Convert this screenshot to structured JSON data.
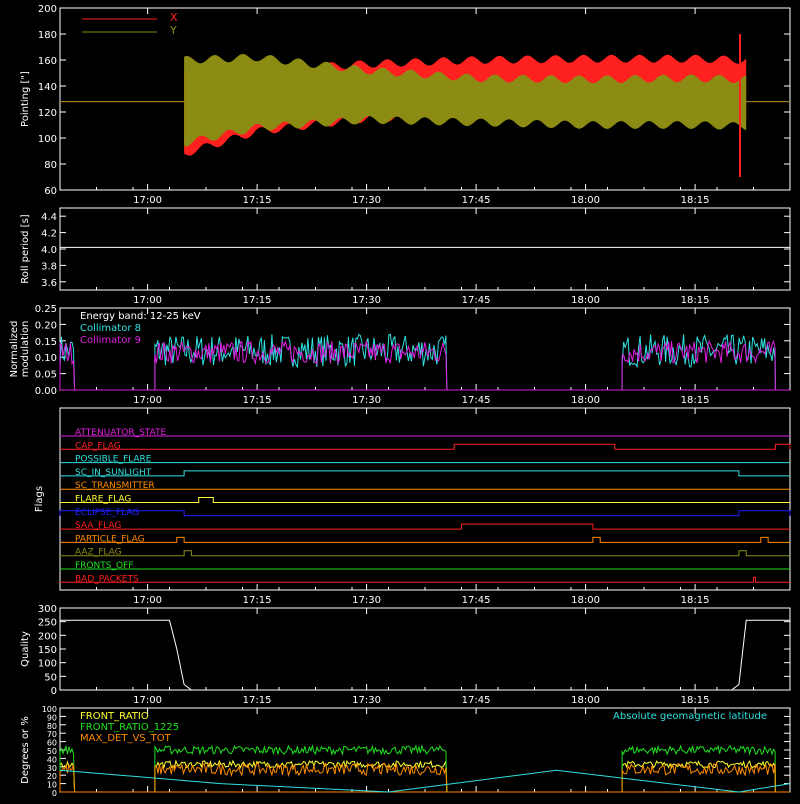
{
  "colors": {
    "background": "#000000",
    "axes": "#ffffff",
    "red": "#ff2020",
    "olive": "#8c8c14",
    "cyan": "#30e0e0",
    "magenta": "#e020e0",
    "green": "#20e020",
    "orange": "#ff8c00",
    "yellow": "#ffff30",
    "blue": "#2020ff",
    "pink": "#ff40a0",
    "white": "#ffffff"
  },
  "time_axis": {
    "start": "16:48",
    "end": "18:28",
    "ticks": [
      "17:00",
      "17:15",
      "17:30",
      "17:45",
      "18:00",
      "18:15"
    ]
  },
  "chart_data": [
    {
      "id": "pointing",
      "type": "area",
      "ylabel": "Pointing [\"]",
      "ylim": [
        60,
        200
      ],
      "yticks": [
        60,
        80,
        100,
        120,
        140,
        160,
        180,
        200
      ],
      "legend": {
        "placement": "top-left",
        "entries": [
          "X",
          "Y"
        ]
      },
      "series": [
        {
          "name": "X",
          "color": "red",
          "x": [
            "16:48",
            "17:05",
            "17:15",
            "17:30",
            "17:45",
            "18:00",
            "18:15",
            "18:22",
            "18:28"
          ],
          "lower": [
            128,
            88,
            105,
            115,
            117,
            117,
            116,
            115,
            128
          ],
          "upper": [
            128,
            150,
            152,
            157,
            160,
            161,
            161,
            160,
            128
          ]
        },
        {
          "name": "Y",
          "color": "olive",
          "x": [
            "16:48",
            "17:05",
            "17:15",
            "17:30",
            "17:45",
            "18:00",
            "18:15",
            "18:22",
            "18:28"
          ],
          "lower": [
            128,
            96,
            108,
            114,
            112,
            110,
            110,
            109,
            128
          ],
          "upper": [
            128,
            160,
            162,
            152,
            146,
            145,
            146,
            145,
            128
          ]
        }
      ]
    },
    {
      "id": "roll",
      "type": "line",
      "ylabel": "Roll period [s]",
      "ylim": [
        3.5,
        4.5
      ],
      "yticks": [
        3.6,
        3.8,
        4.0,
        4.2,
        4.4
      ],
      "series": [
        {
          "color": "white",
          "x": [
            "16:48",
            "18:28"
          ],
          "y": [
            4.02,
            4.02
          ]
        }
      ]
    },
    {
      "id": "modulation",
      "type": "line",
      "ylabel": "Normalized modulation",
      "ylim": [
        0,
        0.25
      ],
      "yticks": [
        0.0,
        0.05,
        0.1,
        0.15,
        0.2,
        0.25
      ],
      "annotation": "Energy band: 12-25 keV",
      "legend": {
        "placement": "top-left",
        "entries": [
          "Collimator 8",
          "Collimator 9"
        ]
      },
      "segments": [
        [
          "16:48",
          "16:50"
        ],
        [
          "17:01",
          "17:41"
        ],
        [
          "18:05",
          "18:26"
        ]
      ],
      "series": [
        {
          "name": "Collimator 8",
          "color": "cyan",
          "mean": 0.12,
          "spread": 0.05
        },
        {
          "name": "Collimator 9",
          "color": "magenta",
          "mean": 0.115,
          "spread": 0.035
        }
      ]
    },
    {
      "id": "flags",
      "type": "line",
      "ylabel": "Flags",
      "rows": [
        {
          "name": "ATTENUATOR_STATE",
          "color": "magenta",
          "highs": []
        },
        {
          "name": "CAP_FLAG",
          "color": "red",
          "highs": [
            [
              "17:42",
              "18:04"
            ],
            [
              "18:26",
              "18:28"
            ]
          ]
        },
        {
          "name": "POSSIBLE_FLARE",
          "color": "cyan",
          "highs": []
        },
        {
          "name": "SC_IN_SUNLIGHT",
          "color": "cyan",
          "highs": [
            [
              "17:05",
              "18:21"
            ]
          ]
        },
        {
          "name": "SC_TRANSMITTER",
          "color": "orange",
          "highs": []
        },
        {
          "name": "FLARE_FLAG",
          "color": "yellow",
          "highs": [
            [
              "17:07",
              "17:09"
            ]
          ]
        },
        {
          "name": "ECLIPSE_FLAG",
          "color": "blue",
          "highs": [
            [
              "16:48",
              "17:05"
            ],
            [
              "18:21",
              "18:28"
            ]
          ]
        },
        {
          "name": "SAA_FLAG",
          "color": "red",
          "highs": [
            [
              "17:43",
              "18:01"
            ]
          ]
        },
        {
          "name": "PARTICLE_FLAG",
          "color": "orange",
          "highs": [
            [
              "17:04",
              "17:05"
            ],
            [
              "18:01",
              "18:02"
            ],
            [
              "18:24",
              "18:25"
            ]
          ]
        },
        {
          "name": "AAZ_FLAG",
          "color": "olive",
          "highs": [
            [
              "17:05",
              "17:06"
            ],
            [
              "18:21",
              "18:22"
            ]
          ]
        },
        {
          "name": "FRONTS_OFF",
          "color": "green",
          "highs": []
        },
        {
          "name": "BAD_PACKETS",
          "color": "red",
          "highs": [
            [
              "18:23",
              "18:23"
            ]
          ]
        }
      ]
    },
    {
      "id": "quality",
      "type": "line",
      "ylabel": "Quality",
      "ylim": [
        0,
        300
      ],
      "yticks": [
        0,
        50,
        100,
        150,
        200,
        250,
        300
      ],
      "series": [
        {
          "color": "white",
          "x": [
            "16:48",
            "17:03",
            "17:04",
            "17:05",
            "17:06",
            "18:20",
            "18:21",
            "18:22",
            "18:28"
          ],
          "y": [
            255,
            255,
            150,
            20,
            0,
            0,
            20,
            255,
            255
          ]
        }
      ]
    },
    {
      "id": "ratios",
      "type": "line",
      "ylabel": "Degrees or %",
      "ylim": [
        0,
        100
      ],
      "yticks": [
        0,
        10,
        20,
        30,
        40,
        50,
        60,
        70,
        80,
        90,
        100
      ],
      "annotation": "Absolute geomagnetic latitude",
      "legend": {
        "placement": "top-left",
        "entries": [
          "FRONT_RATIO",
          "FRONT_RATIO_1225",
          "MAX_DET_VS_TOT"
        ]
      },
      "segments": [
        [
          "16:48",
          "16:50"
        ],
        [
          "17:01",
          "17:41"
        ],
        [
          "18:05",
          "18:26"
        ]
      ],
      "series": [
        {
          "name": "FRONT_RATIO",
          "color": "yellow",
          "mean": 33,
          "spread": 4
        },
        {
          "name": "FRONT_RATIO_1225",
          "color": "green",
          "mean": 50,
          "spread": 5
        },
        {
          "name": "MAX_DET_VS_TOT",
          "color": "orange",
          "mean": 27,
          "spread": 7
        },
        {
          "name": "Absolute geomagnetic latitude",
          "color": "cyan",
          "x": [
            "16:48",
            "17:10",
            "17:33",
            "17:56",
            "18:21",
            "18:28"
          ],
          "y": [
            26,
            10,
            0,
            26,
            0,
            10
          ]
        }
      ]
    }
  ]
}
